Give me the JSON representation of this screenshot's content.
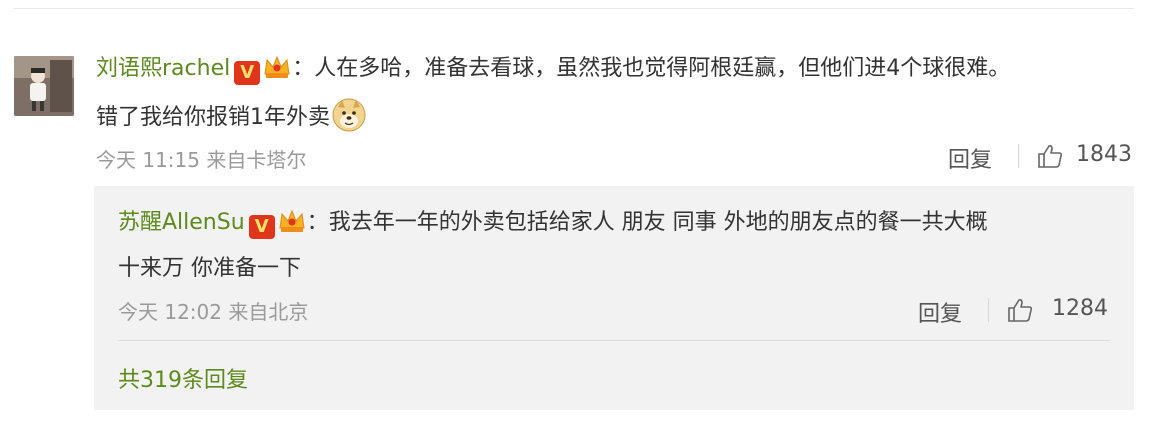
{
  "comment": {
    "username": "刘语熙rachel",
    "badge_v": "V",
    "separator": "：",
    "text_line1": "人在多哈，准备去看球，虽然我也觉得阿根廷赢，但他们进4个球很难。",
    "text_line2": "错了我给你报销1年外卖",
    "time": "今天 11:15",
    "source": "来自卡塔尔",
    "reply_label": "回复",
    "like_count": "1843"
  },
  "reply": {
    "username": "苏醒AllenSu",
    "badge_v": "V",
    "separator": "：",
    "text_line1": "我去年一年的外卖包括给家人 朋友 同事 外地的朋友点的餐一共大概",
    "text_line2": "十来万 你准备一下",
    "time": "今天 12:02",
    "source": "来自北京",
    "reply_label": "回复",
    "like_count": "1284"
  },
  "total_replies": "共319条回复",
  "colors": {
    "username": "#5c8a1c",
    "vip_badge": "#e0341b",
    "reply_bg": "#f2f2f2"
  }
}
